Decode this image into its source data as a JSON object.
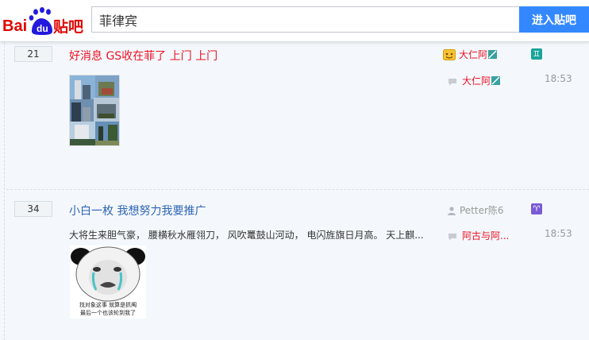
{
  "header": {
    "logo_text": "Bai du 贴吧",
    "search_value": "菲律宾",
    "enter_button": "进入贴吧"
  },
  "colors": {
    "accent": "#3388ff",
    "title_red": "#ee1122",
    "title_blue": "#2d64b3"
  },
  "threads": [
    {
      "reply_count": "21",
      "title": "好消息 GS收在菲了 上门 上门",
      "author": "大仁阿",
      "last_reply_user": "大仁阿",
      "time": "18:53",
      "zodiac_icon": "gemini-icon",
      "author_icon": "vip-face-icon"
    },
    {
      "reply_count": "34",
      "title": "小白一枚 我想努力我要推广",
      "author": "Petter陈6",
      "last_reply_user": "阿古与阿...",
      "time": "18:53",
      "excerpt": "大将生来胆气豪， 腰横秋水雁翎刀， 风吹鼍鼓山河动， 电闪旌旗日月高。 天上麒...",
      "zodiac_icon": "aries-icon",
      "author_icon": "user-icon",
      "meme_caption_line1": "找对象这事 就算是抓阄",
      "meme_caption_line2": "最后一个也该轮到我了"
    }
  ]
}
